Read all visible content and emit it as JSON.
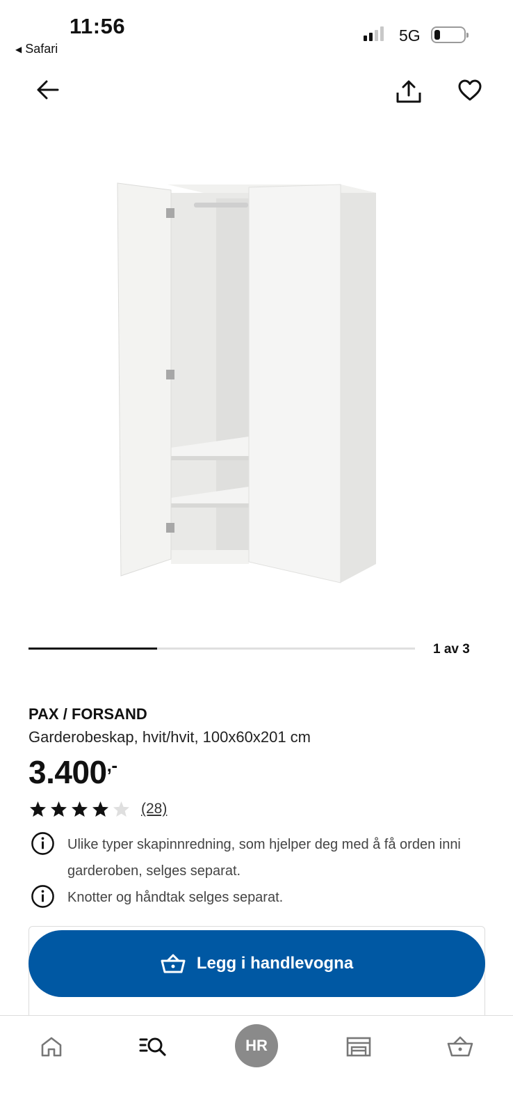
{
  "status_bar": {
    "time": "11:56",
    "back_app": "Safari",
    "network": "5G"
  },
  "nav": {
    "back_icon": "arrow-left-icon",
    "share_icon": "share-icon",
    "favorite_icon": "heart-icon"
  },
  "gallery": {
    "counter": "1 av 3",
    "current": 1,
    "total": 3
  },
  "product": {
    "name": "PAX / FORSAND",
    "description": "Garderobeskap, hvit/hvit, 100x60x201 cm",
    "price": "3.400",
    "price_suffix": ",-",
    "rating": 4,
    "rating_max": 5,
    "review_count": "(28)"
  },
  "notices": [
    {
      "icon": "info-icon",
      "text": "Ulike typer skapinnredning, som hjelper deg med å få orden inni garderoben, selges separat."
    },
    {
      "icon": "info-icon",
      "text": "Knotter og håndtak selges separat."
    }
  ],
  "cart": {
    "label": "Legg i handlevogna",
    "icon": "basket-icon",
    "color": "#0058a3"
  },
  "bottom_nav": {
    "items": [
      {
        "name": "home",
        "icon": "home-icon"
      },
      {
        "name": "search",
        "icon": "search-list-icon"
      },
      {
        "name": "profile",
        "initials": "HR"
      },
      {
        "name": "stores",
        "icon": "store-icon"
      },
      {
        "name": "cart",
        "icon": "basket-icon"
      }
    ]
  }
}
